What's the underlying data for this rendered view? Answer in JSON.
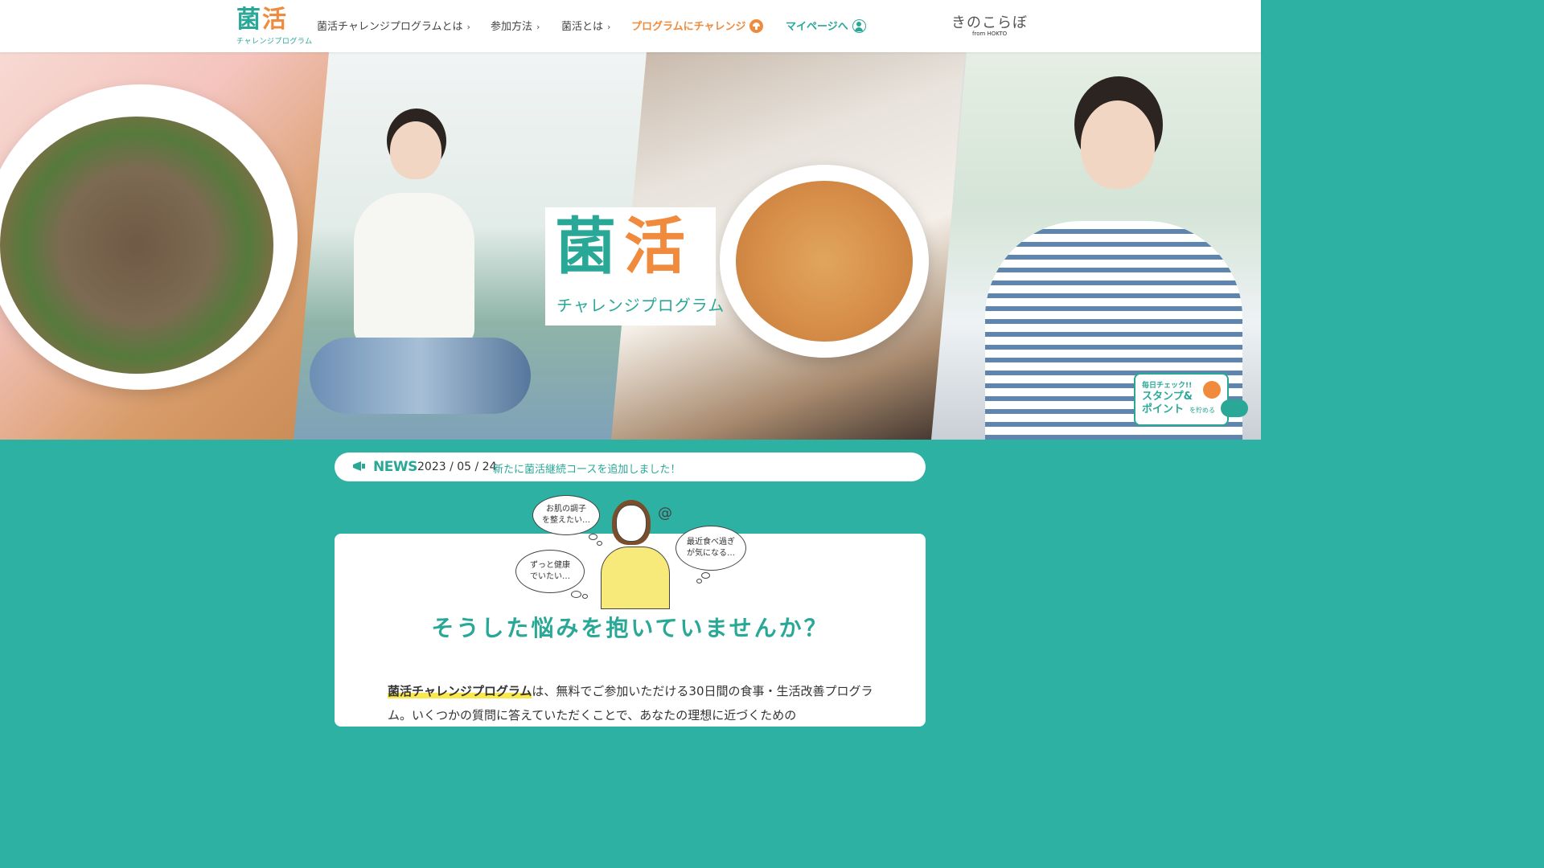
{
  "header": {
    "logo": {
      "kanji1": "菌",
      "kanji2": "活",
      "subtitle": "チャレンジプログラム"
    },
    "nav": [
      {
        "label": "菌活チャレンジプログラムとは",
        "chevron": "›"
      },
      {
        "label": "参加方法",
        "chevron": "›"
      },
      {
        "label": "菌活とは",
        "chevron": "›"
      },
      {
        "label": "プログラムにチャレンジ",
        "icon": "mushroom-icon"
      },
      {
        "label": "マイページへ",
        "icon": "user-icon"
      }
    ],
    "brand": {
      "name": "きのこらぼ",
      "from": "from HOKTO"
    }
  },
  "hero": {
    "logo": {
      "kanji1": "菌",
      "kanji2": "活",
      "subtitle": "チャレンジプログラム"
    },
    "stamp_banner": {
      "line1": "毎日チェック!!",
      "line2": "スタンプ&",
      "line3": "ポイント",
      "suffix": "を貯める"
    }
  },
  "news": {
    "label": "NEWS",
    "date": "2023 / 05 / 24",
    "text": "新たに菌活継続コースを追加しました！"
  },
  "worries": {
    "bubbles": [
      {
        "lines": [
          "お肌の調子",
          "を整えたい…"
        ]
      },
      {
        "lines": [
          "最近食べ過ぎ",
          "が気になる…"
        ]
      },
      {
        "lines": [
          "ずっと健康",
          "でいたい…"
        ]
      }
    ],
    "question": "そうした悩みを抱いていませんか？",
    "body_highlight": "菌活チャレンジプログラム",
    "body_text": "は、無料でご参加いただける30日間の食事・生活改善プログラム。いくつかの質問に答えていただくことで、あなたの理想に近づくための"
  },
  "colors": {
    "teal": "#2aa897",
    "background": "#2db1a2",
    "orange": "#f08a3c",
    "highlight": "#fbe84b"
  }
}
